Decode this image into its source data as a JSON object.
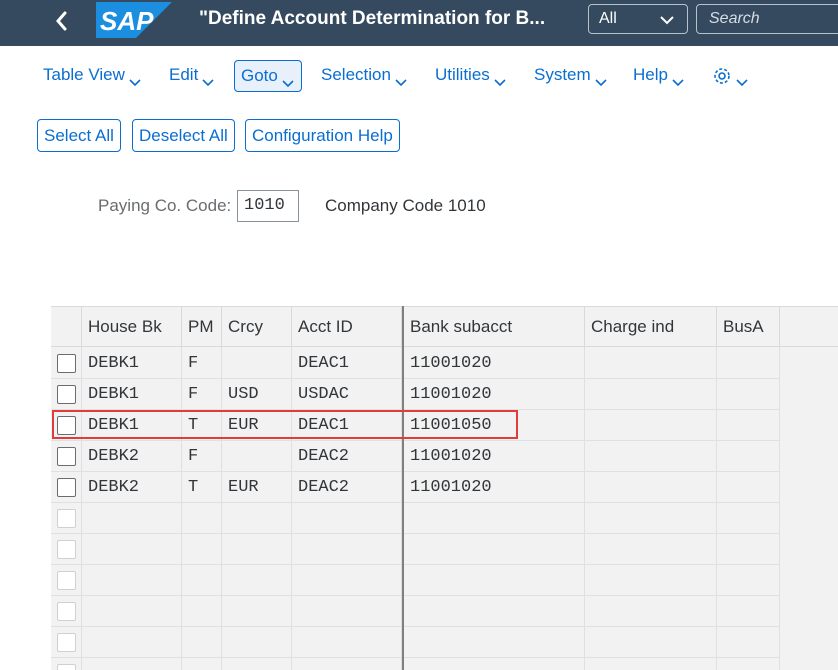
{
  "shell": {
    "title": "\"Define Account Determination for B...",
    "scope_value": "All",
    "search_placeholder": "Search"
  },
  "menu": [
    "Table View",
    "Edit",
    "Goto",
    "Selection",
    "Utilities",
    "System",
    "Help"
  ],
  "buttons": [
    "Select All",
    "Deselect All",
    "Configuration Help"
  ],
  "field": {
    "label": "Paying Co. Code:",
    "value": "1010",
    "description": "Company Code 1010"
  },
  "table": {
    "columns": [
      "House Bk",
      "PM",
      "Crcy",
      "Acct ID",
      "Bank subacct",
      "Charge ind",
      "BusA"
    ],
    "rows": [
      [
        "DEBK1",
        "F",
        "",
        "DEAC1",
        "11001020",
        "",
        ""
      ],
      [
        "DEBK1",
        "F",
        "USD",
        "USDAC",
        "11001020",
        "",
        ""
      ],
      [
        "DEBK1",
        "T",
        "EUR",
        "DEAC1",
        "11001050",
        "",
        ""
      ],
      [
        "DEBK2",
        "F",
        "",
        "DEAC2",
        "11001020",
        "",
        ""
      ],
      [
        "DEBK2",
        "T",
        "EUR",
        "DEAC2",
        "11001020",
        "",
        ""
      ]
    ]
  }
}
